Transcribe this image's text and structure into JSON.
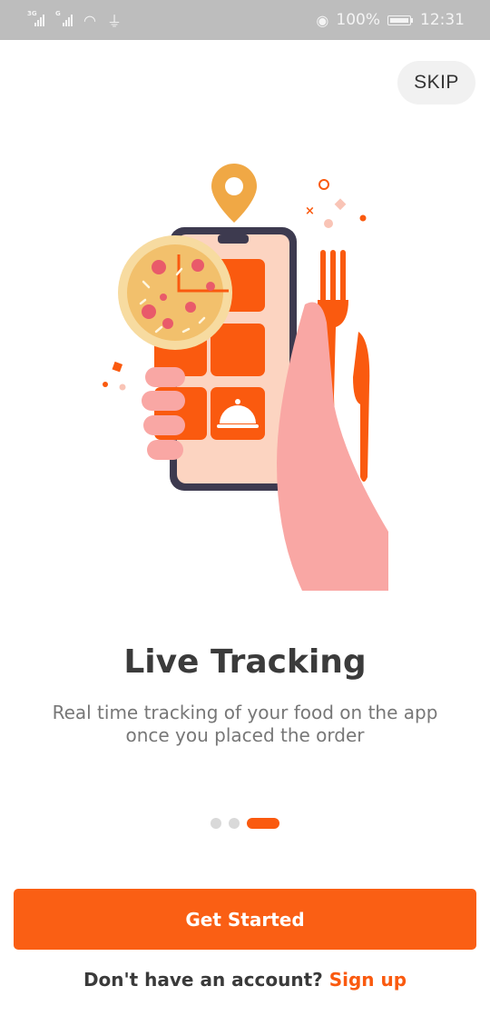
{
  "status_bar": {
    "sim1_tag": "3G",
    "sim2_tag": "G",
    "battery": "100%",
    "time": "12:31"
  },
  "skip_label": "SKIP",
  "onboarding": {
    "title": "Live Tracking",
    "subtitle_line1": "Real time tracking of your food on the app",
    "subtitle_line2": "once you placed the order",
    "pages": 3,
    "active_page": 3
  },
  "cta_label": "Get Started",
  "signup": {
    "prompt": "Don't have an account?",
    "link": "Sign up"
  },
  "colors": {
    "accent": "#fa5a0f",
    "status_bar": "#bdbdbd",
    "title": "#3b3b3b",
    "hand": "#f9a7a4",
    "pizza": "#f2c38a"
  },
  "icons": [
    "eye-icon",
    "wifi-icon",
    "usb-icon",
    "battery-icon",
    "map-pin-icon",
    "food-cloche-icon",
    "fork-icon",
    "knife-icon",
    "pizza-icon"
  ]
}
